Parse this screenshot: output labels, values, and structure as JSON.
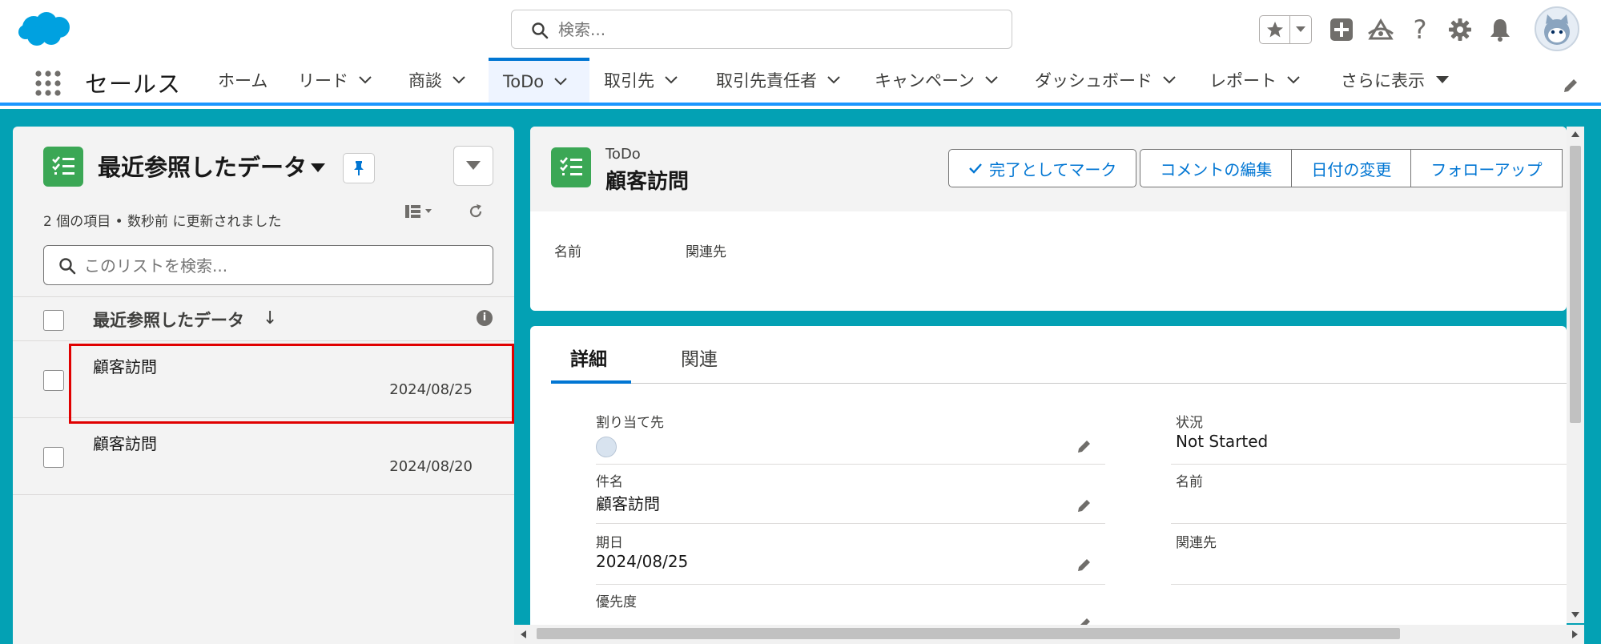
{
  "header": {
    "search_placeholder": "検索...",
    "help_glyph": "?"
  },
  "nav": {
    "app_name": "セールス",
    "items": [
      {
        "label": "ホーム"
      },
      {
        "label": "リード"
      },
      {
        "label": "商談"
      },
      {
        "label": "ToDo"
      },
      {
        "label": "取引先"
      },
      {
        "label": "取引先責任者"
      },
      {
        "label": "キャンペーン"
      },
      {
        "label": "ダッシュボード"
      },
      {
        "label": "レポート"
      },
      {
        "label": "さらに表示"
      }
    ]
  },
  "list": {
    "title": "最近参照したデータ",
    "meta": "2 個の項目 • 数秒前 に更新されました",
    "search_placeholder": "このリストを検索...",
    "column_header": "最近参照したデータ",
    "sort_glyph": "↓",
    "info_glyph": "i",
    "rows": [
      {
        "name": "顧客訪問",
        "date": "2024/08/25"
      },
      {
        "name": "顧客訪問",
        "date": "2024/08/20"
      }
    ]
  },
  "record": {
    "object_type": "ToDo",
    "title": "顧客訪問",
    "actions": {
      "mark_complete": "完了としてマーク",
      "edit_comment": "コメントの編集",
      "change_date": "日付の変更",
      "follow_up": "フォローアップ"
    },
    "highlights": {
      "name_label": "名前",
      "related_label": "関連先"
    }
  },
  "detail": {
    "tabs": [
      {
        "label": "詳細"
      },
      {
        "label": "関連"
      }
    ],
    "fields": {
      "assigned_to_label": "割り当て先",
      "subject_label": "件名",
      "subject_value": "顧客訪問",
      "due_date_label": "期日",
      "due_date_value": "2024/08/25",
      "priority_label": "優先度",
      "status_label": "状況",
      "status_value": "Not Started",
      "name_label": "名前",
      "related_label": "関連先"
    }
  },
  "colors": {
    "brand_blue": "#0176d3",
    "nav_accent": "#1b96ff",
    "teal_background": "#03a1b4",
    "task_green": "#3ba755",
    "highlight_red": "#e00000"
  },
  "icons": [
    "salesforce-cloud-icon",
    "search-icon",
    "star-icon",
    "add-icon",
    "trailhead-icon",
    "help-icon",
    "gear-icon",
    "bell-icon",
    "app-launcher-icon",
    "pencil-icon",
    "task-icon",
    "pin-icon",
    "refresh-icon",
    "checkmark-icon",
    "info-icon"
  ]
}
